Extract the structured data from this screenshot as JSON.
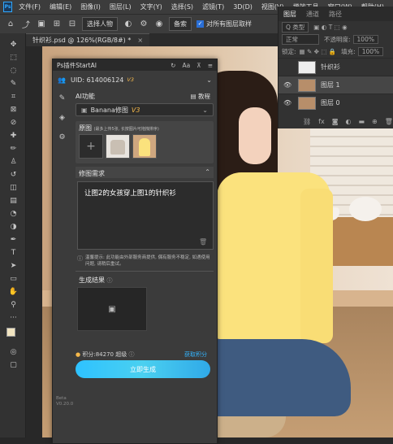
{
  "menu": {
    "logo": "Ps",
    "items": [
      "文件(F)",
      "编辑(E)",
      "图像(I)",
      "图层(L)",
      "文字(Y)",
      "选择(S)",
      "滤镜(T)",
      "3D(D)",
      "视图(V)",
      "增效工具",
      "窗口(W)",
      "帮助(H)"
    ]
  },
  "options": {
    "select_subject": "选择人物",
    "sample": "备索",
    "sample_all_layers": "对所有图层取样"
  },
  "doc_tab": {
    "title": "针织衫.psd @ 126%(RGB/8#) *",
    "close": "×"
  },
  "layers_panel": {
    "tabs": [
      "图层",
      "通道",
      "路径"
    ],
    "filter_label": "Q 类型",
    "blend_mode": "正常",
    "opacity_label": "不透明度:",
    "opacity_value": "100%",
    "lock_label": "锁定:",
    "fill_label": "填充:",
    "fill_value": "100%",
    "layers": [
      {
        "name": "针织衫",
        "visible": false
      },
      {
        "name": "图层 1",
        "visible": true
      },
      {
        "name": "图层 0",
        "visible": true
      }
    ]
  },
  "plugin": {
    "title": "Ps插件StartAI",
    "uid": "UID: 614006124",
    "uid_badge": "V3",
    "ai_function_label": "AI功能",
    "tutorial": "教程",
    "model": "Banana修图",
    "model_badge": "V3",
    "original_label": "原图",
    "original_hint": "(最多上传5张, 长按图片可拖拽排序)",
    "requirement_label": "修图需求",
    "prompt": "让图2的女孩穿上图1的针织衫",
    "tip": "温馨提示: 此功能由外部服务商提供, 偶有服务不稳定, 如遇使用问题, 请稍后重试。",
    "result_label": "生成结果",
    "points": "积分:84270",
    "points_note": "超级",
    "get_points": "获取积分",
    "generate_button": "立即生成",
    "version": "Beta V0.20.0"
  }
}
